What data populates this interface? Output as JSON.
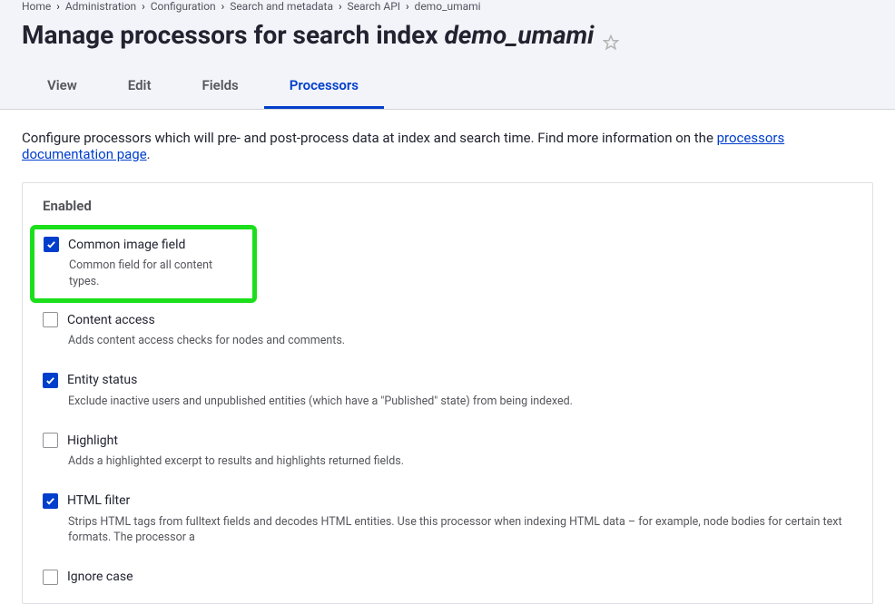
{
  "breadcrumb": {
    "home": "Home",
    "admin": "Administration",
    "config": "Configuration",
    "search_meta": "Search and metadata",
    "search_api": "Search API",
    "index": "demo_umami"
  },
  "title": {
    "prefix": "Manage processors for search index ",
    "index_name": "demo_umami"
  },
  "tabs": {
    "view": "View",
    "edit": "Edit",
    "fields": "Fields",
    "processors": "Processors"
  },
  "intro": {
    "text_before_link": "Configure processors which will pre- and post-process data at index and search time. Find more information on the ",
    "link_text": "processors documentation page",
    "text_after_link": "."
  },
  "panel": {
    "header": "Enabled"
  },
  "processors": {
    "common_image": {
      "label": "Common image field",
      "desc": "Common field for all content types."
    },
    "content_access": {
      "label": "Content access",
      "desc": "Adds content access checks for nodes and comments."
    },
    "entity_status": {
      "label": "Entity status",
      "desc": "Exclude inactive users and unpublished entities (which have a \"Published\" state) from being indexed."
    },
    "highlight": {
      "label": "Highlight",
      "desc": "Adds a highlighted excerpt to results and highlights returned fields."
    },
    "html_filter": {
      "label": "HTML filter",
      "desc": "Strips HTML tags from fulltext fields and decodes HTML entities. Use this processor when indexing HTML data – for example, node bodies for certain text formats. The processor a"
    },
    "ignore_case": {
      "label": "Ignore case"
    }
  }
}
